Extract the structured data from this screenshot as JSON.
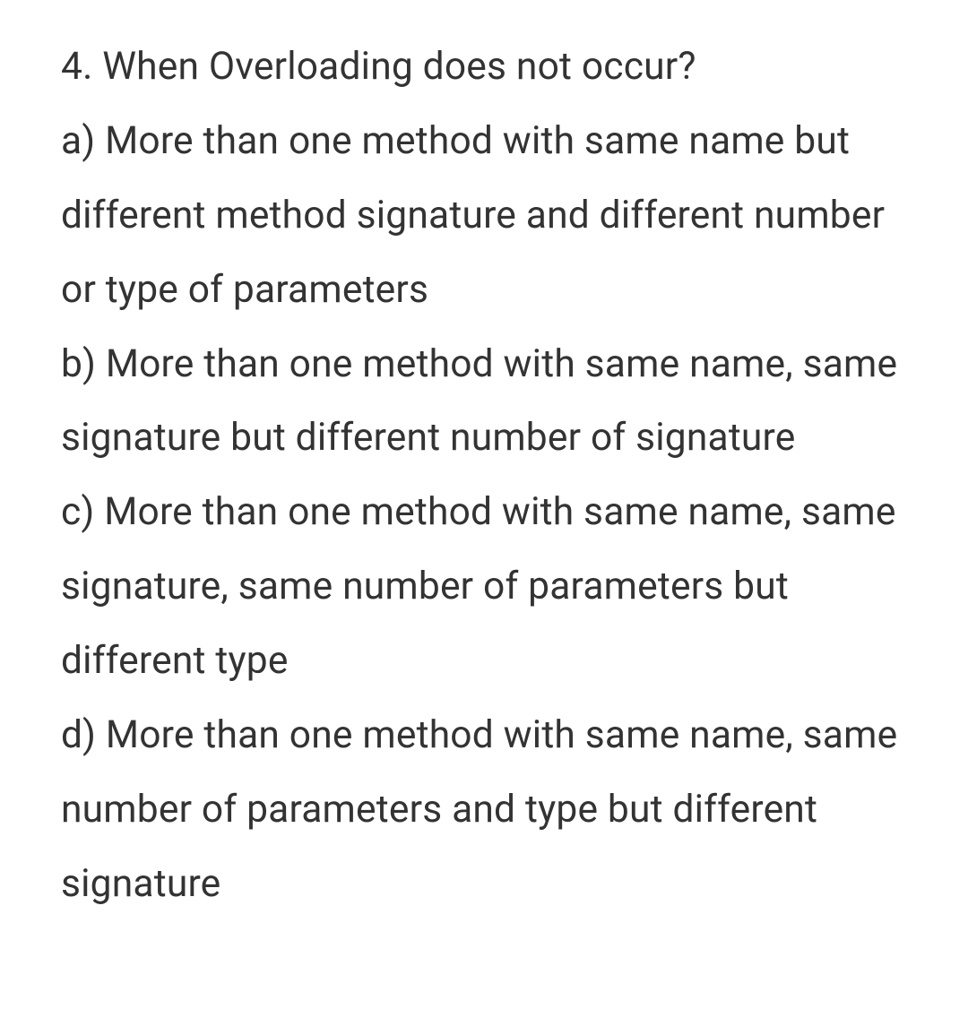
{
  "question": {
    "number": "4.",
    "text": "When Overloading does not occur?"
  },
  "options": [
    {
      "label": "a)",
      "text": "More than one method with same name but different method signature and different number or type of parameters"
    },
    {
      "label": "b)",
      "text": "More than one method with same name, same signature but different number of signature"
    },
    {
      "label": "c)",
      "text": "More than one method with same name, same signature, same number of parameters but different type"
    },
    {
      "label": "d)",
      "text": "More than one method with same name, same number of parameters and type but different signature"
    }
  ]
}
